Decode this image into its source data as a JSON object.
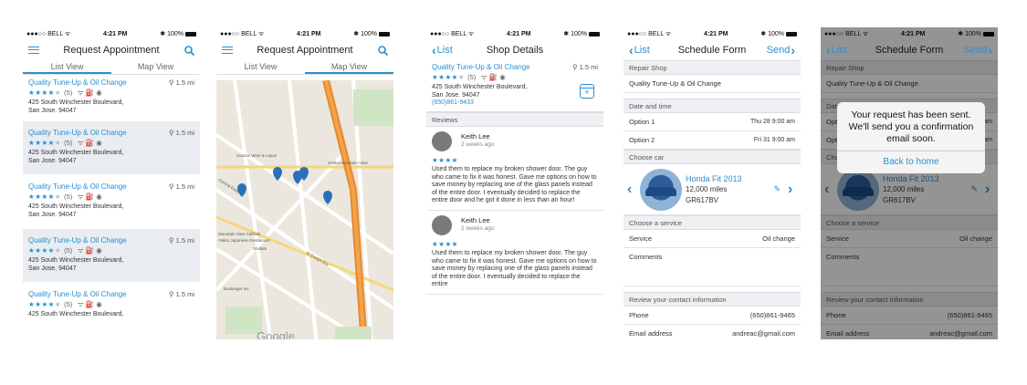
{
  "status": {
    "carrier": "●●●○○ BELL ᯤ",
    "time": "4:21 PM",
    "battery": "✱ 100%"
  },
  "shop": {
    "name": "Quality Tune-Up & Oil Change",
    "distance": "1.5 mi",
    "stars_on": "★★★★",
    "stars_off": "★",
    "reviews": "(5)",
    "amenities": "ᯤ ⛽ ◉",
    "address_line1": "425 South Winchester Boulevard,",
    "address_line2": "San Jose. 94047",
    "phone": "(650)861-9433"
  },
  "screen1": {
    "title": "Request Appointment",
    "tabs": [
      "List View",
      "Map View"
    ]
  },
  "screen2": {
    "title": "Request Appointment",
    "tabs": [
      "List View",
      "Map View"
    ],
    "map_labels": [
      "Sousas Wine & Liquor",
      "Gekko Mountain View",
      "Mountain View Caltrain",
      "Yakko Japanese Restaurant",
      "Shalala",
      "Castro St",
      "W Evelyn Ave",
      "Central Expy",
      "Bernardo Ave",
      "Moffett Blvd",
      "Stevens Creek Trail",
      "Google",
      "Wright Ave",
      "Villa St",
      "Mercy St",
      "Dana St",
      "Church St",
      "Latham St",
      "Shoreline Blvd",
      "Boulanger Inc"
    ]
  },
  "screen3": {
    "back": "List",
    "title": "Shop Details",
    "reviews_header": "Reviews",
    "reviews": [
      {
        "name": "Keith Lee",
        "date": "2 weeks ago",
        "stars": "★★★★",
        "text": "Used them to replace my broken shower door. The guy who came to fix it was honest. Gave me options on how to save money by replacing one of the glass panels instead of the entire door. I eventually decided to replace the entire door and he got it done in less than an hour!"
      },
      {
        "name": "Keith Lee",
        "date": "2 weeks ago",
        "stars": "★★★★",
        "text": "Used them to replace my broken shower door. The guy who came to fix it was honest. Gave me options on how to save money by replacing one of the glass panels instead of the entire door. I eventually decided to replace the entire"
      }
    ]
  },
  "form": {
    "back": "List",
    "title": "Schedule Form",
    "send": "Send",
    "repair_shop_label": "Repair Shop",
    "repair_shop_value": "Quality Tune-Up & Oil Change",
    "date_label": "Date and time",
    "option1": "Option 1",
    "option1_value": "Thu 28 9:00 am",
    "option2": "Option 2",
    "option2_value": "Fri 31 9:00 am",
    "car_label": "Choose car",
    "car_name": "Honda Fit 2013",
    "car_miles": "12,000 miles",
    "car_plate": "GR617BV",
    "service_label": "Choose a service",
    "service": "Service",
    "service_value": "Oil change",
    "comments": "Comments",
    "contact_label": "Review your contact information",
    "phone_label": "Phone",
    "phone_value": "(650)861-9465",
    "email_label": "Email address",
    "email_value": "andreac@gmail.com"
  },
  "dialog": {
    "message": "Your request has been sent. We'll send you a confirmation email soon.",
    "button": "Back to home"
  },
  "colors": {
    "accent": "#2a8fcf",
    "row_alt": "#e9ecf1",
    "section_bg": "#eef0f3"
  }
}
